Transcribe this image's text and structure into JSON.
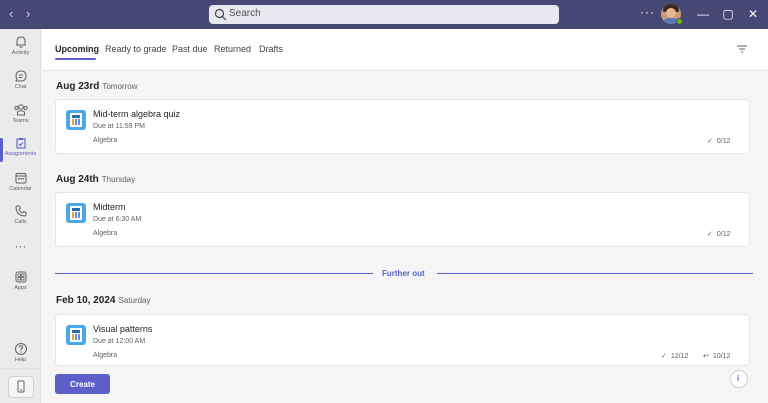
{
  "titlebar": {
    "search_placeholder": "Search",
    "more_label": "···"
  },
  "rail": {
    "items": [
      {
        "label": "Activity",
        "icon": "bell-icon"
      },
      {
        "label": "Chat",
        "icon": "chat-icon"
      },
      {
        "label": "Teams",
        "icon": "teams-icon"
      },
      {
        "label": "Assignments",
        "icon": "assignments-icon",
        "active": true
      },
      {
        "label": "Calendar",
        "icon": "calendar-icon"
      },
      {
        "label": "Calls",
        "icon": "phone-icon"
      },
      {
        "label": "Apps",
        "icon": "apps-icon"
      },
      {
        "label": "Help",
        "icon": "help-icon"
      }
    ],
    "more_label": "···"
  },
  "tabs": [
    {
      "label": "Upcoming",
      "active": true
    },
    {
      "label": "Ready to grade"
    },
    {
      "label": "Past due"
    },
    {
      "label": "Returned"
    },
    {
      "label": "Drafts"
    }
  ],
  "groups": [
    {
      "date": "Aug 23rd",
      "sub": "Tomorrow",
      "cards": [
        {
          "title": "Mid-term algebra quiz",
          "due": "Due at 11:59 PM",
          "class": "Algebra",
          "turned_in": "0/12"
        }
      ]
    },
    {
      "date": "Aug 24th",
      "sub": "Thursday",
      "cards": [
        {
          "title": "Midterm",
          "due": "Due at 6:30 AM",
          "class": "Algebra",
          "turned_in": "0/12"
        }
      ]
    },
    {
      "date": "Feb 10, 2024",
      "sub": "Saturday",
      "cards": [
        {
          "title": "Visual patterns",
          "due": "Due at 12:00 AM",
          "class": "Algebra",
          "turned_in": "12/12",
          "returned": "10/12"
        }
      ]
    }
  ],
  "divider_label": "Further out",
  "create_label": "Create",
  "info_label": "i",
  "colors": {
    "titlebar": "#464775",
    "accent": "#5b5fc7",
    "background": "#f5f5f5"
  }
}
